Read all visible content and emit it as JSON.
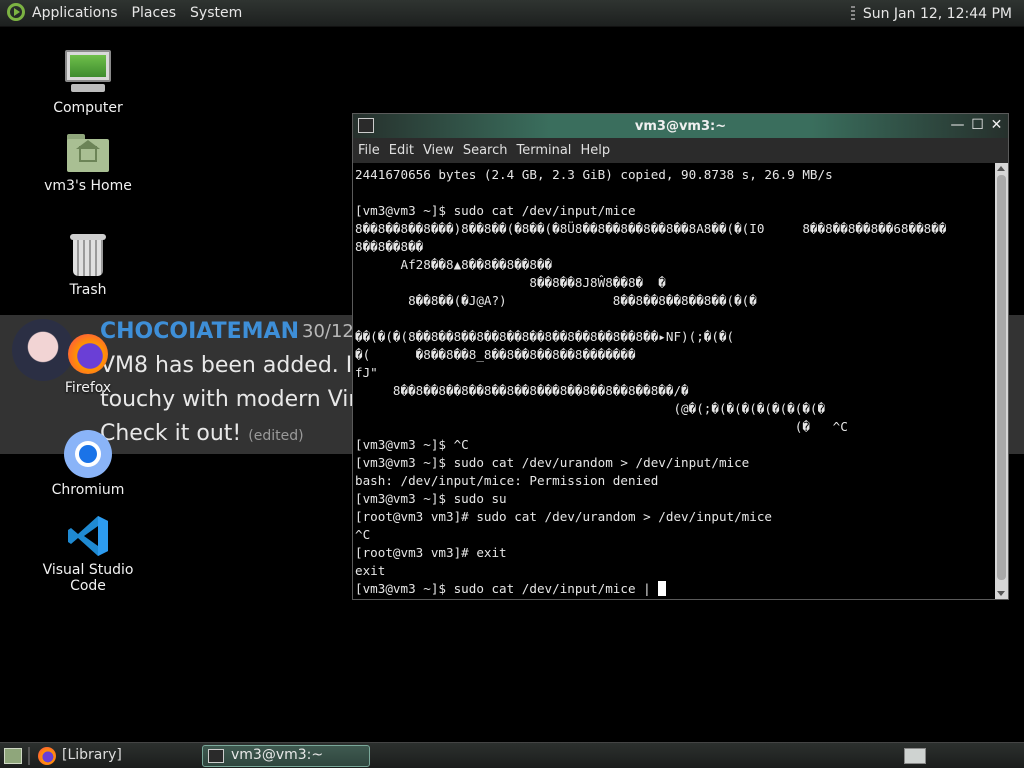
{
  "top_panel": {
    "menus": [
      "Applications",
      "Places",
      "System"
    ],
    "clock": "Sun Jan 12, 12:44 PM"
  },
  "desktop": {
    "icons": [
      {
        "label": "Computer",
        "icon": "computer-icon"
      },
      {
        "label": "vm3's Home",
        "icon": "home-folder-icon"
      },
      {
        "label": "Trash",
        "icon": "trash-icon"
      },
      {
        "label": "Firefox",
        "icon": "firefox-icon"
      },
      {
        "label": "Chromium",
        "icon": "chromium-icon"
      },
      {
        "label": "Visual Studio Code",
        "icon": "vscode-icon"
      }
    ]
  },
  "notification": {
    "author": "CHOCOIATEMAN",
    "date": "30/12,",
    "line1": "VM8 has been added. It",
    "line2": "touchy with modern Virti",
    "line3": "Check it out!",
    "edited": "(edited)"
  },
  "terminal": {
    "title": "vm3@vm3:~",
    "menu": [
      "File",
      "Edit",
      "View",
      "Search",
      "Terminal",
      "Help"
    ],
    "lines": [
      "2441670656 bytes (2.4 GB, 2.3 GiB) copied, 90.8738 s, 26.9 MB/s",
      "",
      "[vm3@vm3 ~]$ sudo cat /dev/input/mice",
      "8��8��8��8���)8��8��(�8��(�8Ü8��8��8��8��8��8A8��(�(I0     8��8��8��8��68��8��",
      "8��8��8��",
      "      Af28��8▲8��8��8��8��",
      "                       8��8��8J8Ŵ8��8�  �",
      "       8��8��(�J@A?)              8��8��8��8��8��(�(�",
      "",
      "��(�(�(8��8��8��8��8��8��8��8��8��8��8��▸NF)(;�(�(",
      "�(      �8��8��8_8��8��8��8��8�������",
      "fJ\"",
      "     8��8��8��8��8��8��8���8��8��8��8��8��/�",
      "                                          (@�(;�(�(�(�(�(�(�(�",
      "                                                          (�   ^C",
      "[vm3@vm3 ~]$ ^C",
      "[vm3@vm3 ~]$ sudo cat /dev/urandom > /dev/input/mice",
      "bash: /dev/input/mice: Permission denied",
      "[vm3@vm3 ~]$ sudo su",
      "[root@vm3 vm3]# sudo cat /dev/urandom > /dev/input/mice",
      "^C",
      "[root@vm3 vm3]# exit",
      "exit"
    ],
    "prompt_line": "[vm3@vm3 ~]$ sudo cat /dev/input/mice | "
  },
  "taskbar": {
    "library": "[Library]",
    "terminal_task": "vm3@vm3:~"
  }
}
